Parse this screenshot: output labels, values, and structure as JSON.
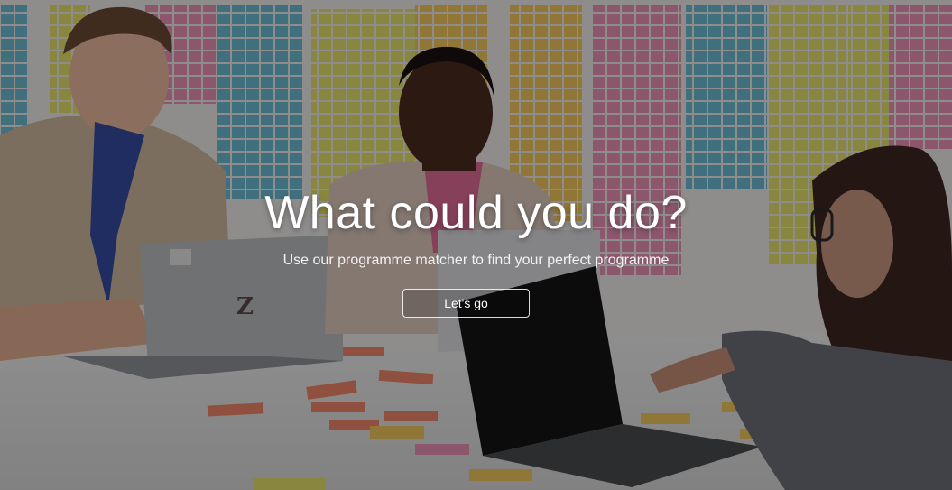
{
  "hero": {
    "title": "What could you do?",
    "subtitle": "Use our programme matcher to find your perfect programme",
    "cta_label": "Let's go",
    "laptop_logo": "Z"
  },
  "colors": {
    "overlay": "#000000",
    "text": "#ffffff",
    "sticky_pink": "#e88ab0",
    "sticky_blue": "#69b8cf",
    "sticky_yellow": "#e6e06a",
    "sticky_orange": "#f4c25a",
    "sticky_salmon": "#f0866c"
  }
}
